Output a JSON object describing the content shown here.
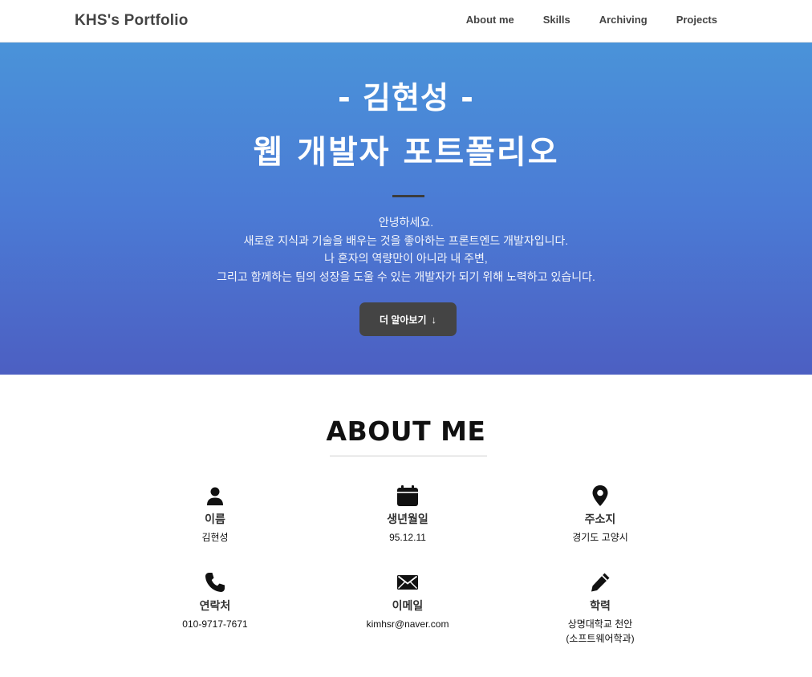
{
  "nav": {
    "brand": "KHS's Portfolio",
    "links": [
      "About me",
      "Skills",
      "Archiving",
      "Projects"
    ]
  },
  "hero": {
    "name": "- 김현성 -",
    "title": "웹 개발자 포트폴리오",
    "intro": [
      "안녕하세요.",
      "새로운 지식과 기술을 배우는 것을 좋아하는 프론트엔드 개발자입니다.",
      "나 혼자의 역량만이 아니라 내 주변,",
      "그리고 함께하는 팀의 성장을 도울 수 있는 개발자가 되기 위해 노력하고 있습니다."
    ],
    "button_label": "더 알아보기",
    "button_icon": "arrow-down-icon"
  },
  "about": {
    "title": "ABOUT ME",
    "items": [
      {
        "icon": "user-icon",
        "label": "이름",
        "value": "김현성"
      },
      {
        "icon": "calendar-icon",
        "label": "생년월일",
        "value": "95.12.11"
      },
      {
        "icon": "location-pin-icon",
        "label": "주소지",
        "value": "경기도 고양시"
      },
      {
        "icon": "phone-icon",
        "label": "연락처",
        "value": "010-9717-7671"
      },
      {
        "icon": "mail-icon",
        "label": "이메일",
        "value": "kimhsr@naver.com"
      },
      {
        "icon": "pencil-icon",
        "label": "학력",
        "value": "상명대학교 천안",
        "value2": "(소프트웨어학과)"
      }
    ]
  },
  "colors": {
    "hero_gradient_top": "#4a93d9",
    "hero_gradient_bottom": "#4c5fc2",
    "button_bg": "#444444"
  }
}
